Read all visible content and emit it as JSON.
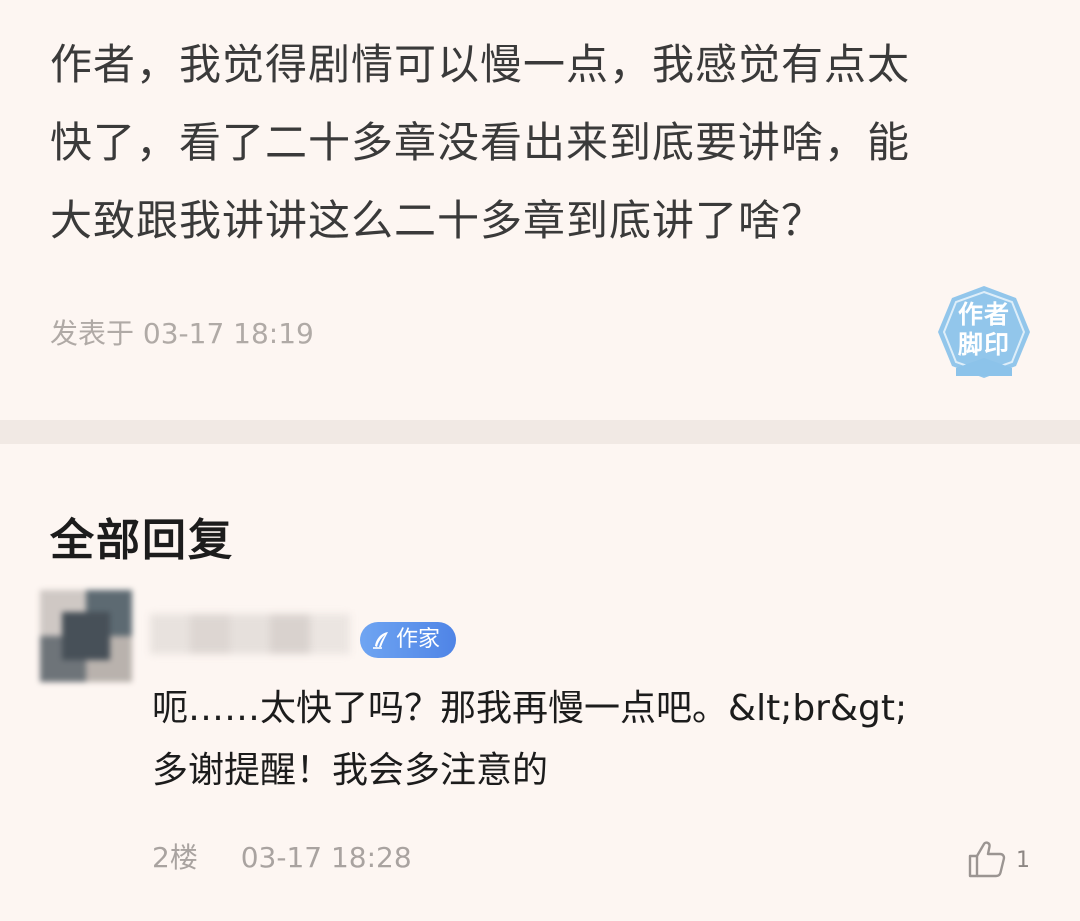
{
  "post": {
    "lines": [
      "作者，我觉得剧情可以慢一点，我感觉有点太",
      "快了，看了二十多章没看出来到底要讲啥，能",
      "大致跟我讲讲这么二十多章到底讲了啥？"
    ],
    "time": "发表于 03-17 18:19",
    "stamp": {
      "line1": "作者",
      "line2": "脚印",
      "color": "#8cc3ea"
    }
  },
  "replies_section": {
    "title": "全部回复"
  },
  "reply": {
    "badge": "作家",
    "lines": [
      "呃……太快了吗？那我再慢一点吧。&lt;br&gt;",
      "多谢提醒！我会多注意的"
    ],
    "floor": "2楼",
    "time": "03-17 18:28",
    "likes": "1",
    "badge_color": "#5b8ff0"
  },
  "colors": {
    "background": "#fdf6f2",
    "divider": "#f1e9e4",
    "text_primary": "#1c1c1c",
    "text_secondary": "#b0aaa6"
  }
}
